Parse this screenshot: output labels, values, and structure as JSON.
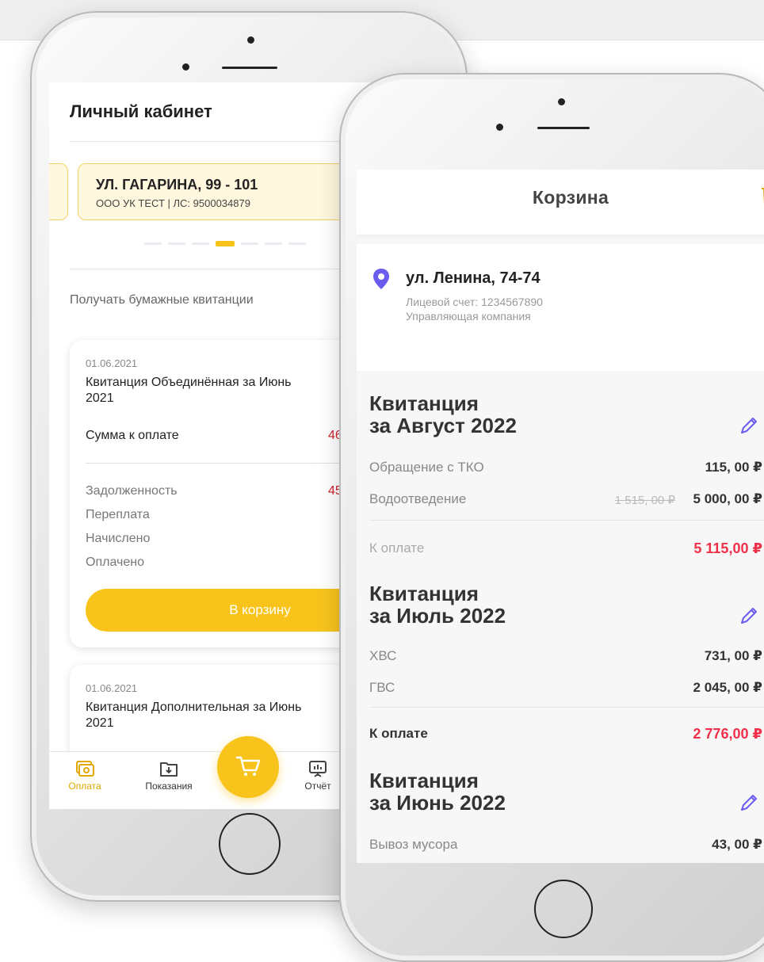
{
  "left_phone": {
    "title": "Личный кабинет",
    "address": {
      "street": "УЛ. ГАГАРИНА, 99 - 101",
      "details": "ООО УК ТЕСТ | ЛС: 9500034879"
    },
    "paper_receipts_label": "Получать бумажные квитанции",
    "receipts": [
      {
        "date": "01.06.2021",
        "title": "Квитанция Объединённая за Июнь 2021",
        "sum_label": "Сумма к оплате",
        "sum_value_partial": "46",
        "rows": [
          {
            "label": "Задолженность",
            "value_partial": "45"
          },
          {
            "label": "Переплата",
            "value_partial": ""
          },
          {
            "label": "Начислено",
            "value_partial": ""
          },
          {
            "label": "Оплачено",
            "value_partial": ""
          }
        ],
        "button_label": "В корзину"
      },
      {
        "date": "01.06.2021",
        "title": "Квитанция Дополнительная за Июнь 2021"
      }
    ],
    "tabbar": {
      "pay": "Оплата",
      "readings": "Показания",
      "reports_partial": "Отчёт"
    }
  },
  "right_phone": {
    "header_title": "Корзина",
    "location": {
      "street": "ул. Ленина, 74-74",
      "account": "Лицевой счет: 1234567890",
      "company": "Управляющая компания"
    },
    "sections": [
      {
        "title_line1": "Квитанция",
        "title_line2": "за Август 2022",
        "items": [
          {
            "name": "Обращение с ТКО",
            "old": "",
            "amount": "115, 00 ₽"
          },
          {
            "name": "Водоотведение",
            "old": "1 515, 00 ₽",
            "amount": "5 000, 00 ₽"
          }
        ],
        "total_label": "К оплате",
        "total": "5 115,00 ₽"
      },
      {
        "title_line1": "Квитанция",
        "title_line2": "за Июль 2022",
        "items": [
          {
            "name": "ХВС",
            "old": "",
            "amount": "731, 00 ₽"
          },
          {
            "name": "ГВС",
            "old": "",
            "amount": "2 045, 00 ₽"
          }
        ],
        "total_label": "К оплате",
        "total": "2 776,00 ₽"
      },
      {
        "title_line1": "Квитанция",
        "title_line2": "за Июнь 2022",
        "items": [
          {
            "name": "Вывоз мусора",
            "old": "",
            "amount": "43, 00 ₽"
          }
        ]
      }
    ]
  },
  "colors": {
    "accent_yellow": "#f8c41c",
    "debt_red": "#d0202d",
    "total_red": "#f0304a",
    "pin_blue": "#6b5cf0"
  },
  "icons": {
    "trash": "trash-icon",
    "pin": "location-pin-icon",
    "edit": "pencil-icon",
    "cart": "cart-icon",
    "pay": "wallet-icon",
    "readings": "download-folder-icon",
    "reports": "presentation-chart-icon"
  }
}
